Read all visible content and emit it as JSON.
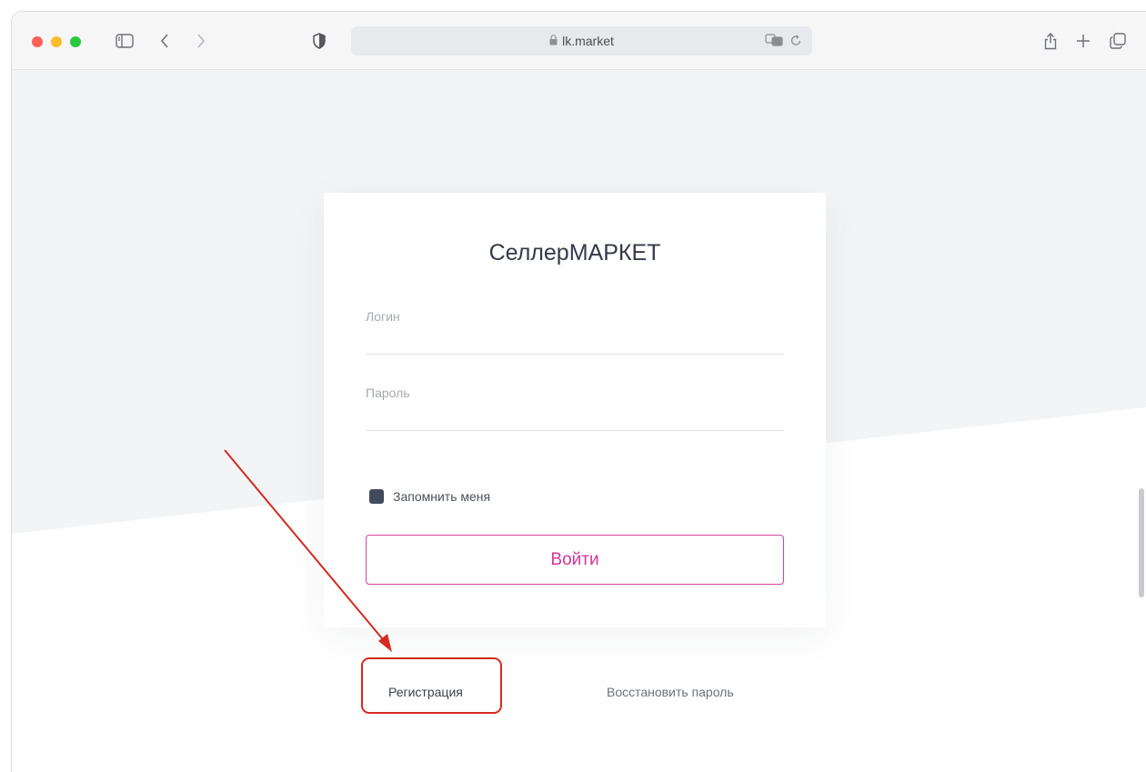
{
  "browser": {
    "url": "lk.market",
    "icons": {
      "sidebar": "sidebar-icon",
      "back": "chevron-left-icon",
      "forward": "chevron-right-icon",
      "privacy": "shield-icon",
      "lock": "lock-icon",
      "translate": "translate-icon",
      "reload": "reload-icon",
      "share": "share-icon",
      "new_tab": "plus-icon",
      "tabs": "tabs-overview-icon"
    }
  },
  "login_form": {
    "title": "СеллерМАРКЕТ",
    "login_placeholder": "Логин",
    "password_placeholder": "Пароль",
    "remember_label": "Запомнить меня",
    "submit_label": "Войти"
  },
  "links": {
    "register": "Регистрация",
    "restore_password": "Восстановить пароль"
  },
  "colors": {
    "accent": "#d4349a",
    "annotation": "#d42a22",
    "checkbox": "#424a5e"
  }
}
